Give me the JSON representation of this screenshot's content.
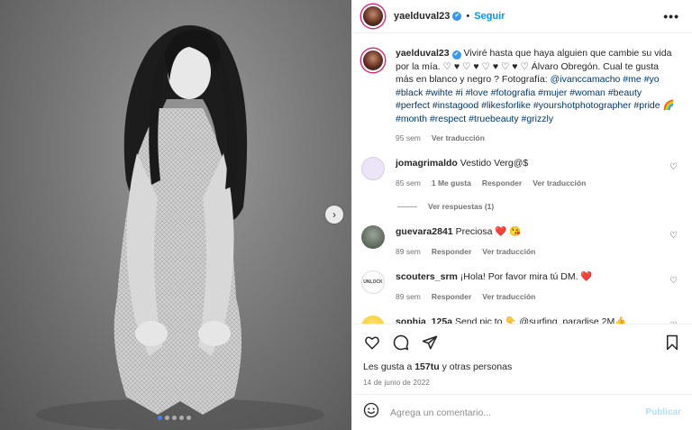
{
  "post": {
    "username": "yaelduval23",
    "follow_label": "Seguir",
    "separator": "•",
    "more_label": "•••",
    "verified_glyph": "✔"
  },
  "caption": {
    "username": "yaelduval23",
    "text_1": "Viviré hasta que haya alguien que cambie su vida por la mía. ♡ ♥ ♡ ♥ ♡ ♥ ♡ ♥ ♡ Álvaro Obregón. Cual te gusta más en blanco y negro ? Fotografía: ",
    "photographer_tag": "@ivanccamacho",
    "hashtags_1": " #me #yo #black #wihte #i #love #fotografia #mujer #woman #beauty #perfect #instagood #likesforlike #yourshotphotographer #pride ",
    "rainbow": "🌈",
    "hashtags_2": " #month #respect #truebeauty #grizzly",
    "time": "95 sem",
    "translate": "Ver traducción"
  },
  "comments": [
    {
      "username": "jomagrimaldo",
      "text": "Vestido Verg@$",
      "time": "85 sem",
      "likes": "1 Me gusta",
      "reply": "Responder",
      "translate": "Ver traducción",
      "avatar_color": "#d9c9ef"
    },
    {
      "username": "guevara2841",
      "text": "Preciosa ❤️ 😘",
      "time": "89 sem",
      "reply": "Responder",
      "translate": "Ver traducción",
      "avatar_color": "#5a6b5a"
    },
    {
      "username": "scouters_srm",
      "text": "¡Hola! Por favor mira tú DM. ❤️",
      "time": "89 sem",
      "reply": "Responder",
      "translate": "Ver traducción",
      "avatar_color": "#ffffff"
    },
    {
      "username": "sophia_125a",
      "text": "Send pic to 👇 @surfing_paradise 2M👍",
      "avatar_color": "#f5c518"
    }
  ],
  "replies_label": "Ver respuestas (1)",
  "avatar_label_scouters": "UNLOCK",
  "likes": {
    "prefix": "Les gusta a ",
    "count": "157tu",
    "suffix": " y otras personas"
  },
  "date": "14 de junio de 2022",
  "add_comment": {
    "placeholder": "Agrega un comentario...",
    "publish": "Publicar"
  },
  "colors": {
    "accent": "#0095f6",
    "verified": "#3897f0",
    "hashtag": "#00376b",
    "carousel_active": "#3b82f6"
  }
}
